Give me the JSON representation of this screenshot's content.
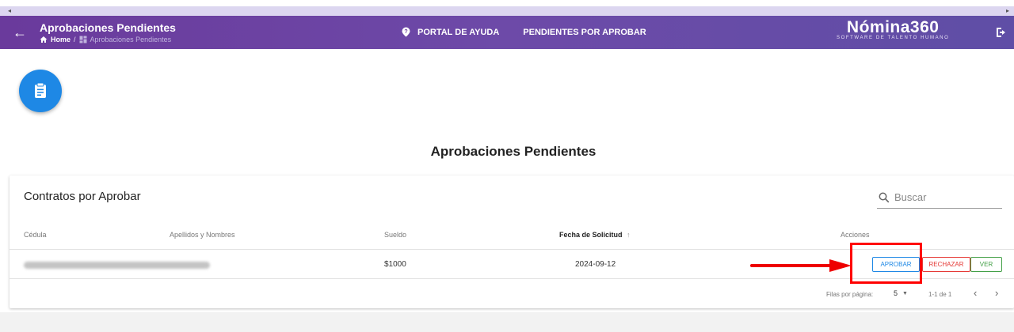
{
  "header": {
    "title": "Aprobaciones Pendientes",
    "breadcrumb_home": "Home",
    "breadcrumb_sep": "/",
    "breadcrumb_current": "Aprobaciones Pendientes",
    "help_link": "PORTAL DE AYUDA",
    "pending_link": "PENDIENTES POR APROBAR",
    "brand_name": "Nómina360",
    "brand_tagline": "SOFTWARE DE TALENTO HUMANO"
  },
  "page": {
    "title": "Aprobaciones Pendientes"
  },
  "table": {
    "title": "Contratos por Aprobar",
    "search_placeholder": "Buscar",
    "columns": {
      "cedula": "Cédula",
      "nombres": "Apellidos y Nombres",
      "sueldo": "Sueldo",
      "fecha": "Fecha de Solicitud",
      "acciones": "Acciones"
    },
    "rows": [
      {
        "sueldo": "$1000",
        "fecha": "2024-09-12"
      }
    ],
    "actions": {
      "approve": "APROBAR",
      "reject": "RECHAZAR",
      "view": "VER"
    },
    "pagination": {
      "rows_per_page_label": "Filas por página:",
      "rows_per_page": "5",
      "range": "1-1 de 1"
    }
  },
  "colors": {
    "appbar": "#6a3a9c",
    "primary": "#1e88e5",
    "danger": "#e53935",
    "success": "#43a047",
    "highlight": "#ff0000"
  }
}
